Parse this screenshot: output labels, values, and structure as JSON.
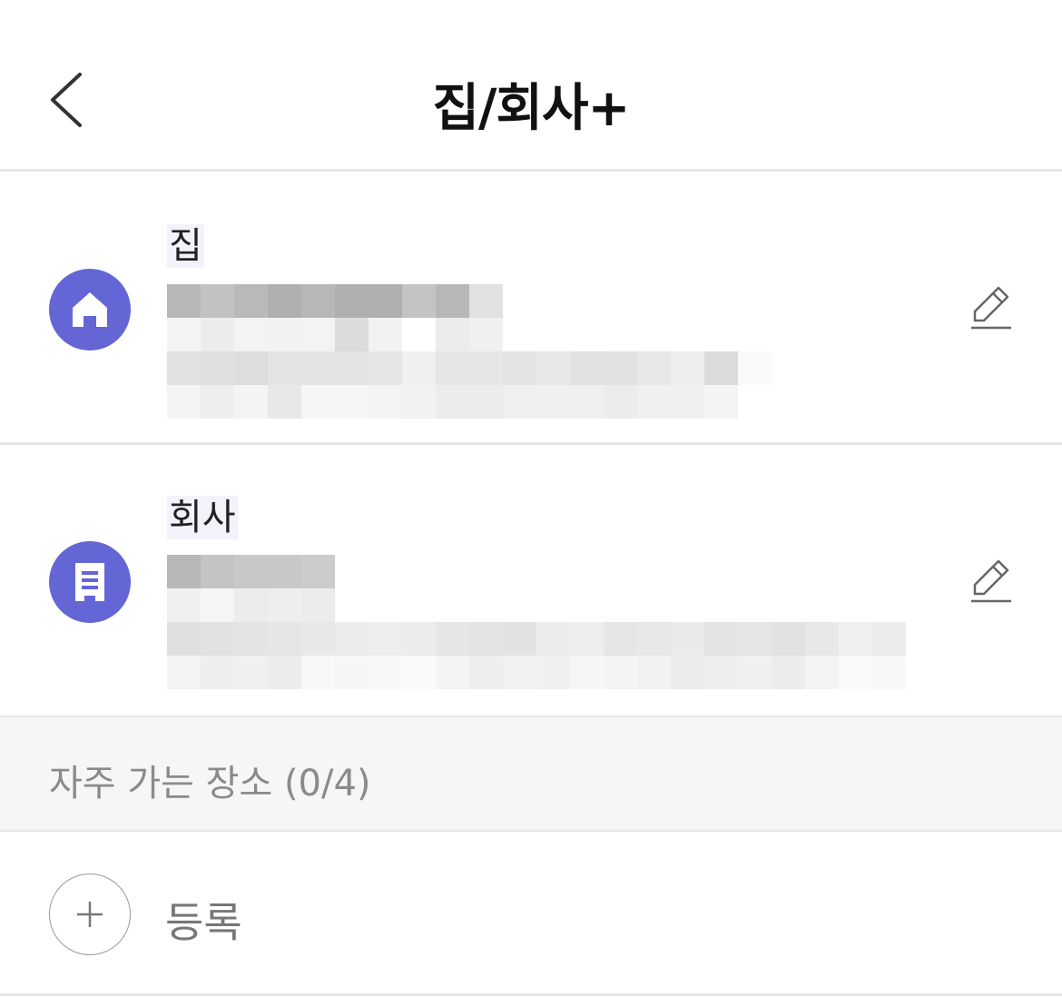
{
  "header": {
    "title": "집/회사+",
    "back_icon": "chevron-left-icon"
  },
  "places": [
    {
      "label": "집",
      "icon": "home-icon",
      "icon_color": "#6466d6",
      "edit_icon": "pencil-icon",
      "address": "",
      "address_detail": ""
    },
    {
      "label": "회사",
      "icon": "building-icon",
      "icon_color": "#6466d6",
      "edit_icon": "pencil-icon",
      "address": "",
      "address_detail": ""
    }
  ],
  "frequent": {
    "title": "자주 가는 장소 (0/4)",
    "add_label": "등록",
    "add_icon": "plus-icon"
  },
  "colors": {
    "accent": "#6466d6",
    "divider": "#e6e6e6",
    "section_bg": "#f6f6f6"
  }
}
